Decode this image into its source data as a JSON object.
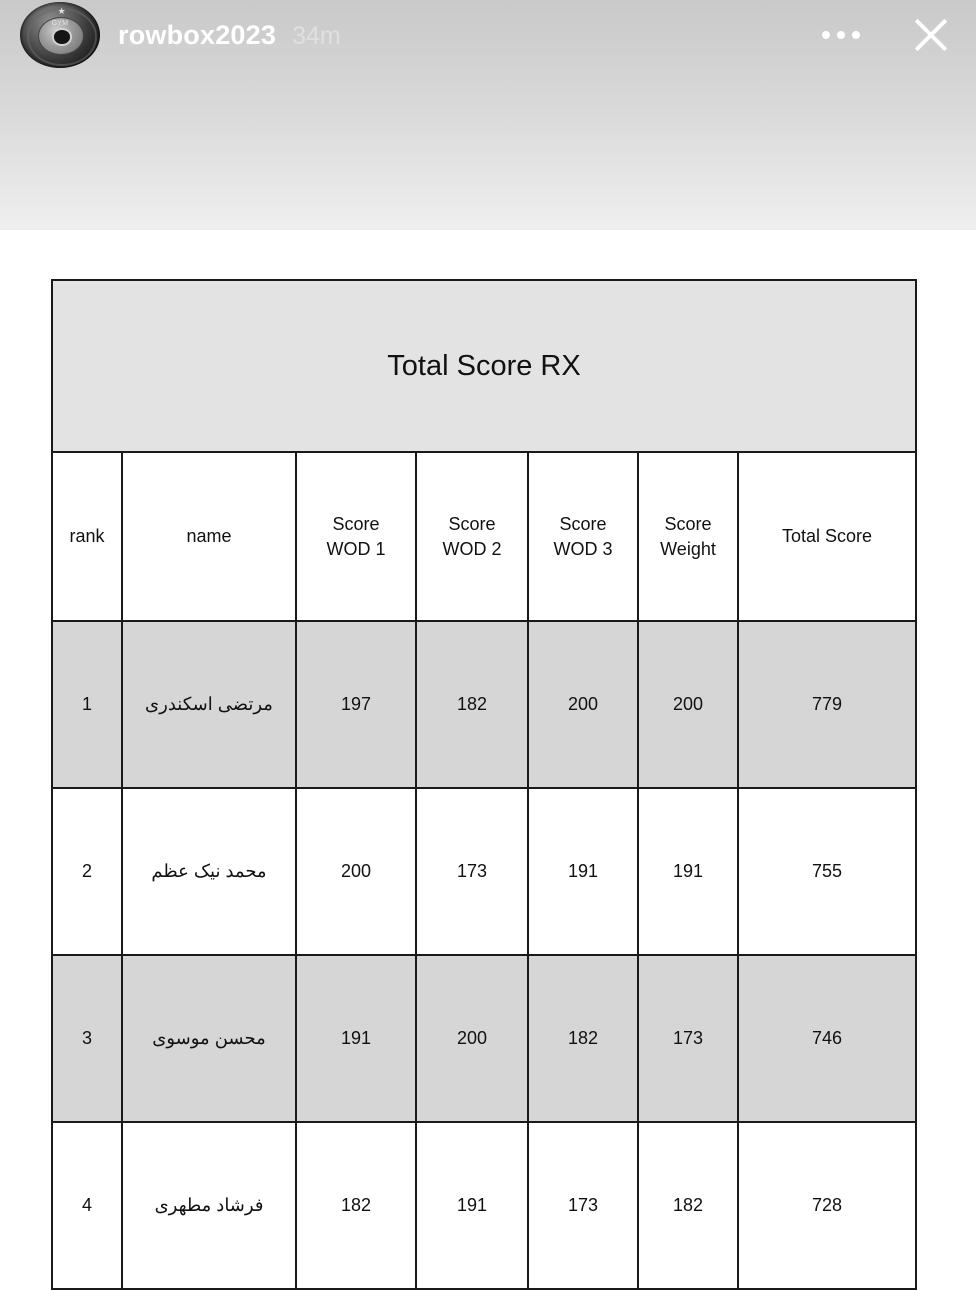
{
  "story": {
    "username": "rowbox2023",
    "timestamp": "34m",
    "avatar_label": "GYM",
    "avatar_icon": "weight-plate-logo",
    "more_icon": "more-options-icon",
    "close_icon": "close-icon"
  },
  "table": {
    "title": "Total Score RX",
    "headers": {
      "rank": "rank",
      "name": "name",
      "wod1_line1": "Score",
      "wod1_line2": "WOD 1",
      "wod2_line1": "Score",
      "wod2_line2": "WOD 2",
      "wod3_line1": "Score",
      "wod3_line2": "WOD 3",
      "weight_line1": "Score",
      "weight_line2": "Weight",
      "total": "Total Score"
    },
    "rows": [
      {
        "rank": "1",
        "name": "مرتضی اسکندری",
        "wod1": "197",
        "wod2": "182",
        "wod3": "200",
        "weight": "200",
        "total": "779"
      },
      {
        "rank": "2",
        "name": "محمد نیک عظم",
        "wod1": "200",
        "wod2": "173",
        "wod3": "191",
        "weight": "191",
        "total": "755"
      },
      {
        "rank": "3",
        "name": "محسن موسوی",
        "wod1": "191",
        "wod2": "200",
        "wod3": "182",
        "weight": "173",
        "total": "746"
      },
      {
        "rank": "4",
        "name": "فرشاد مطهری",
        "wod1": "182",
        "wod2": "191",
        "wod3": "173",
        "weight": "182",
        "total": "728"
      }
    ]
  },
  "colors": {
    "title_fill": "#e3e3e3",
    "row_shaded": "#d6d6d6",
    "row_plain": "#ffffff",
    "border": "#1a1a1a",
    "header_overlay_text": "#ffffff"
  }
}
